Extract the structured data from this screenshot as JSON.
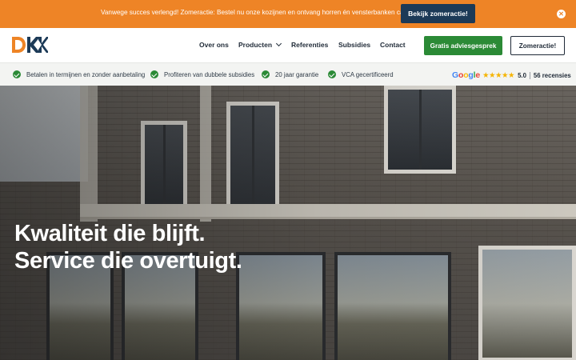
{
  "promo": {
    "text": "Vanwege succes verlengd! Zomeractie: Bestel nu onze kozijnen en ontvang horren én vensterbanken cadeau.",
    "button_label": "Bekijk zomeractie!",
    "close_icon": "close-icon"
  },
  "header": {
    "logo_text": "DKK",
    "nav": [
      {
        "label": "Over ons"
      },
      {
        "label": "Producten",
        "has_dropdown": true
      },
      {
        "label": "Referenties"
      },
      {
        "label": "Subsidies"
      },
      {
        "label": "Contact"
      }
    ],
    "cta_primary": "Gratis adviesgesprek",
    "cta_secondary": "Zomeractie!"
  },
  "usps": [
    {
      "label": "Betalen in termijnen en zonder aanbetaling"
    },
    {
      "label": "Profiteren van dubbele subsidies"
    },
    {
      "label": "20 jaar garantie"
    },
    {
      "label": "VCA gecertificeerd"
    }
  ],
  "rating": {
    "provider": "Google",
    "stars": 5,
    "score": "5.0",
    "reviews": "56 recensies"
  },
  "hero": {
    "headline_line1": "Kwaliteit die blijft.",
    "headline_line2": "Service die overtuigt."
  },
  "colors": {
    "promo_bg": "#ee8426",
    "promo_button": "#1c3a57",
    "green": "#2b8a36",
    "logo_orange": "#ee8426",
    "logo_navy": "#1c3a57"
  }
}
